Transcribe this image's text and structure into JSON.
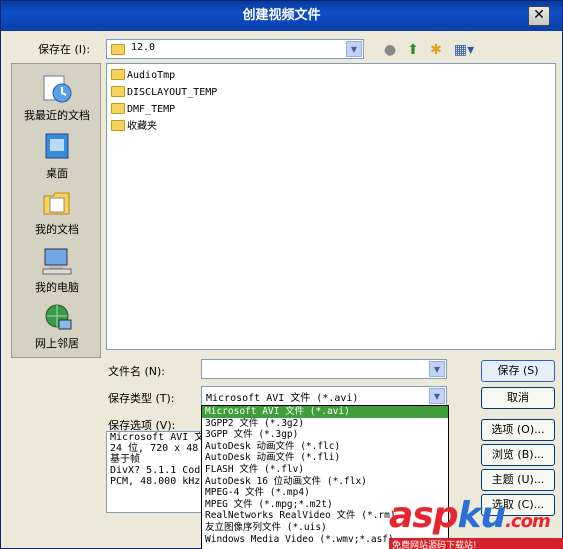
{
  "window": {
    "title": "创建视频文件",
    "close": "✕"
  },
  "top": {
    "save_in_label": "保存在 (I):",
    "location": "12.0"
  },
  "places": [
    {
      "label": "我最近的文档"
    },
    {
      "label": "桌面"
    },
    {
      "label": "我的文档"
    },
    {
      "label": "我的电脑"
    },
    {
      "label": "网上邻居"
    }
  ],
  "files": [
    "AudioTmp",
    "DISCLAYOUT_TEMP",
    "DMF_TEMP",
    "收藏夹"
  ],
  "form": {
    "filename_label": "文件名 (N):",
    "filename_value": "",
    "savetype_label": "保存类型 (T):",
    "savetype_value": "Microsoft AVI 文件 (*.avi)",
    "options_label": "保存选项 (V):"
  },
  "options_text": [
    "Microsoft AVI 文",
    "24 位, 720 x 48",
    "基于帧",
    "DivX? 5.1.1 Cod",
    "PCM, 48.000 kHz"
  ],
  "dropdown_items": [
    "Microsoft AVI 文件 (*.avi)",
    "3GPP2 文件 (*.3g2)",
    "3GPP 文件 (*.3gp)",
    "AutoDesk 动画文件 (*.flc)",
    "AutoDesk 动画文件 (*.fli)",
    "FLASH 文件 (*.flv)",
    "AutoDesk 16 位动画文件 (*.flx)",
    "MPEG-4 文件 (*.mp4)",
    "MPEG 文件 (*.mpg;*.m2t)",
    "RealNetworks RealVideo 文件 (*.rm)",
    "友立图像序列文件 (*.uis)",
    "Windows Media Video (*.wmv;*.asf)"
  ],
  "buttons": {
    "save": "保存 (S)",
    "cancel": "取消",
    "options": "选项 (O)...",
    "browse": "浏览 (B)...",
    "theme": "主题 (U)...",
    "select": "选取 (C)..."
  },
  "watermark": {
    "a": "asp",
    "b": "ku",
    "c": ".com",
    "sub": "免费网站源码下载站!"
  },
  "colors": {
    "titlebar": "#0c4ec8",
    "selection": "#3f9e3a",
    "watermark_red": "#e8242f",
    "watermark_blue": "#2a6fd8"
  }
}
